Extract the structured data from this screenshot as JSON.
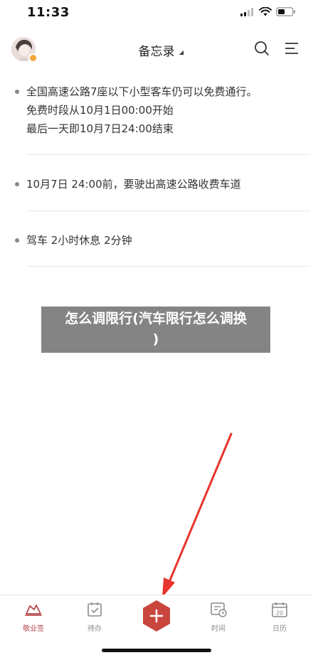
{
  "status": {
    "time": "11:33"
  },
  "header": {
    "title": "备忘录"
  },
  "memos": [
    {
      "lines": [
        "全国高速公路7座以下小型客车仍可以免费通行。",
        "免费时段从10月1日00:00开始",
        "最后一天即10月7日24:00结束"
      ]
    },
    {
      "lines": [
        "10月7日 24:00前，要驶出高速公路收费车道"
      ]
    },
    {
      "lines": [
        "驾车 2小时休息 2分钟"
      ]
    }
  ],
  "overlay": {
    "line1": "怎么调限行(汽车限行怎么调换",
    "line2": ")"
  },
  "tabs": [
    {
      "label": "敬业签",
      "icon": "note-icon",
      "active": true
    },
    {
      "label": "待办",
      "icon": "todo-icon",
      "active": false
    },
    {
      "label": "时间",
      "icon": "time-icon",
      "active": false
    },
    {
      "label": "日历",
      "icon": "calendar-icon",
      "active": false
    }
  ],
  "calendar_day": "20",
  "colors": {
    "accent": "#b84a4e",
    "annotation_arrow": "#e8342c",
    "overlay_bg": "#6e6e6e"
  }
}
